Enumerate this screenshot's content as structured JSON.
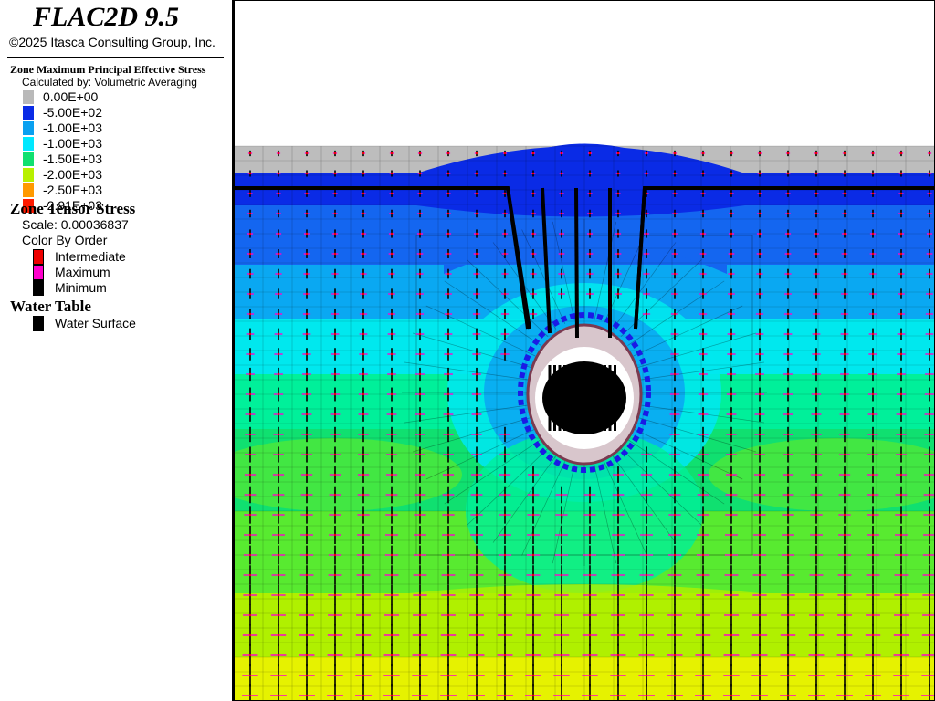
{
  "app": {
    "title": "FLAC2D 9.5",
    "copyright": "©2025 Itasca Consulting Group, Inc."
  },
  "contour": {
    "title": "Zone Maximum Principal Effective Stress",
    "subtitle": "Calculated by: Volumetric Averaging",
    "bands": [
      {
        "label": "0.00E+00",
        "color": "#b9b9b9"
      },
      {
        "label": "-5.00E+02",
        "color": "#0a2be6"
      },
      {
        "label": "-1.00E+03",
        "color": "#0aa0f0"
      },
      {
        "label": "-1.00E+03",
        "color": "#00e8ff"
      },
      {
        "label": "-1.50E+03",
        "color": "#10e070"
      },
      {
        "label": "-2.00E+03",
        "color": "#b8f000"
      },
      {
        "label": "-2.50E+03",
        "color": "#ff9a00"
      },
      {
        "label": "-2.91E+03",
        "color": "#ff1a00"
      }
    ]
  },
  "tensor": {
    "title": "Zone Tensor Stress",
    "scale": "Scale: 0.00036837",
    "color_by": "Color By Order",
    "items": [
      {
        "label": "Intermediate",
        "color": "#ee0000"
      },
      {
        "label": "Maximum",
        "color": "#ff00cc"
      },
      {
        "label": "Minimum",
        "color": "#000000"
      }
    ]
  },
  "water": {
    "title": "Water Table",
    "items": [
      {
        "label": "Water Surface",
        "color": "#000000"
      }
    ]
  }
}
